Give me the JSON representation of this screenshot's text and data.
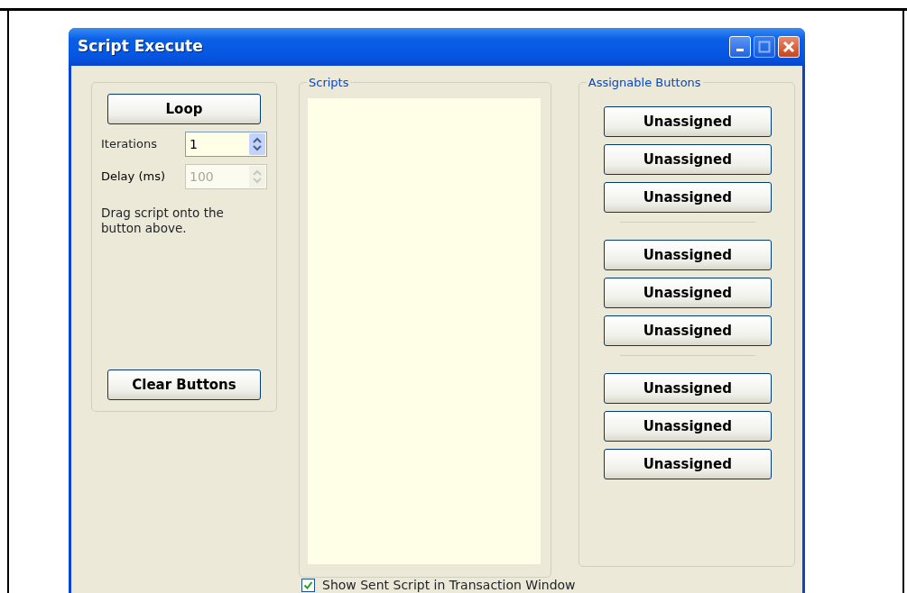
{
  "window": {
    "title": "Script Execute"
  },
  "loop_panel": {
    "loop_button": "Loop",
    "fields": [
      {
        "label": "Iterations",
        "value": "1",
        "disabled": false
      },
      {
        "label": "Delay (ms)",
        "value": "100",
        "disabled": true
      }
    ],
    "hint": "Drag script onto the button above.",
    "clear_button": "Clear Buttons"
  },
  "scripts": {
    "title": "Scripts"
  },
  "assignable": {
    "title": "Assignable Buttons",
    "groups": [
      [
        "Unassigned",
        "Unassigned",
        "Unassigned"
      ],
      [
        "Unassigned",
        "Unassigned",
        "Unassigned"
      ],
      [
        "Unassigned",
        "Unassigned",
        "Unassigned"
      ]
    ]
  },
  "show_sent": {
    "label": "Show Sent Script in Transaction Window",
    "checked": true
  }
}
